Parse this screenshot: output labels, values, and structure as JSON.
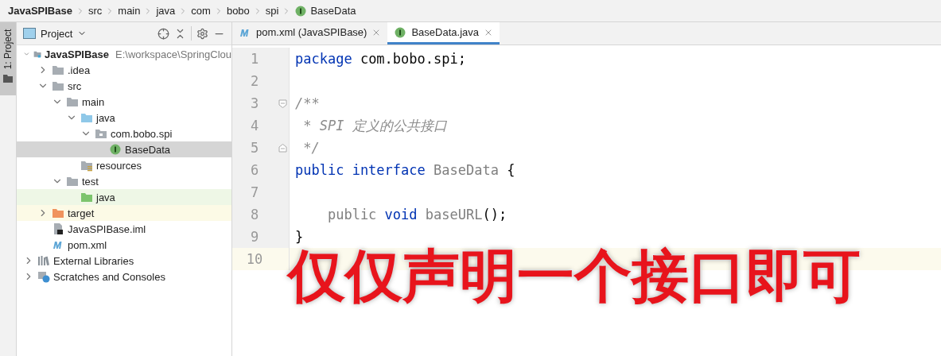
{
  "breadcrumbs": [
    {
      "label": "JavaSPIBase",
      "kind": "project"
    },
    {
      "label": "src",
      "kind": "folder"
    },
    {
      "label": "main",
      "kind": "folder"
    },
    {
      "label": "java",
      "kind": "folder"
    },
    {
      "label": "com",
      "kind": "folder"
    },
    {
      "label": "bobo",
      "kind": "folder"
    },
    {
      "label": "spi",
      "kind": "folder"
    },
    {
      "label": "BaseData",
      "kind": "interface"
    }
  ],
  "side_strip": {
    "tab": "1: Project",
    "selected": true
  },
  "project_panel": {
    "title": "Project",
    "tree": [
      {
        "label": "JavaSPIBase",
        "path": "E:\\workspace\\SpringClou",
        "kind": "module",
        "expanded": true,
        "selected": false,
        "children": [
          {
            "label": ".idea",
            "kind": "folder",
            "expanded": false,
            "selected": false
          },
          {
            "label": "src",
            "kind": "folder",
            "expanded": true,
            "selected": false,
            "children": [
              {
                "label": "main",
                "kind": "folder",
                "expanded": true,
                "selected": false,
                "children": [
                  {
                    "label": "java",
                    "kind": "source",
                    "expanded": true,
                    "selected": false,
                    "children": [
                      {
                        "label": "com.bobo.spi",
                        "kind": "package",
                        "expanded": true,
                        "selected": false,
                        "children": [
                          {
                            "label": "BaseData",
                            "kind": "interface",
                            "selected": true
                          }
                        ]
                      }
                    ]
                  },
                  {
                    "label": "resources",
                    "kind": "resources",
                    "selected": false
                  }
                ]
              },
              {
                "label": "test",
                "kind": "folder",
                "expanded": true,
                "selected": false,
                "children": [
                  {
                    "label": "java",
                    "kind": "test-source",
                    "selected": false
                  }
                ]
              }
            ]
          },
          {
            "label": "target",
            "kind": "excluded",
            "expanded": false,
            "selected": false
          },
          {
            "label": "JavaSPIBase.iml",
            "kind": "iml",
            "selected": false
          },
          {
            "label": "pom.xml",
            "kind": "maven",
            "selected": false
          }
        ]
      },
      {
        "label": "External Libraries",
        "kind": "libraries",
        "expanded": false,
        "selected": false
      },
      {
        "label": "Scratches and Consoles",
        "kind": "scratches",
        "expanded": false,
        "selected": false
      }
    ]
  },
  "editor": {
    "tabs": [
      {
        "label": "pom.xml (JavaSPIBase)",
        "kind": "maven",
        "selected": false
      },
      {
        "label": "BaseData.java",
        "kind": "interface",
        "selected": true
      }
    ],
    "lines": [
      {
        "number": "1",
        "current": false,
        "tokens": [
          {
            "text": "package",
            "kind": "keyword"
          },
          {
            "text": " com.bobo.spi;",
            "kind": "plain"
          }
        ]
      },
      {
        "number": "2",
        "current": false
      },
      {
        "number": "3",
        "current": false,
        "fold_start": true,
        "tokens": [
          {
            "text": "/**",
            "kind": "comment"
          }
        ]
      },
      {
        "number": "4",
        "current": false,
        "tokens": [
          {
            "text": " * SPI 定义的公共接口",
            "kind": "comment"
          }
        ]
      },
      {
        "number": "5",
        "current": false,
        "fold_end": true,
        "tokens": [
          {
            "text": " */",
            "kind": "comment"
          }
        ]
      },
      {
        "number": "6",
        "current": false,
        "tokens": [
          {
            "text": "public interface",
            "kind": "keyword"
          },
          {
            "text": " BaseData",
            "kind": "unused"
          },
          {
            "text": " {",
            "kind": "plain"
          }
        ]
      },
      {
        "number": "7",
        "current": false
      },
      {
        "number": "8",
        "current": false,
        "tokens": [
          {
            "text": "    public",
            "kind": "unused"
          },
          {
            "text": " void",
            "kind": "keyword"
          },
          {
            "text": " baseURL",
            "kind": "unused"
          },
          {
            "text": "();",
            "kind": "plain"
          }
        ]
      },
      {
        "number": "9",
        "current": false,
        "tokens": [
          {
            "text": "}",
            "kind": "plain"
          }
        ]
      },
      {
        "number": "10",
        "current": true
      }
    ]
  },
  "caption": "仅仅声明一个接口即可"
}
